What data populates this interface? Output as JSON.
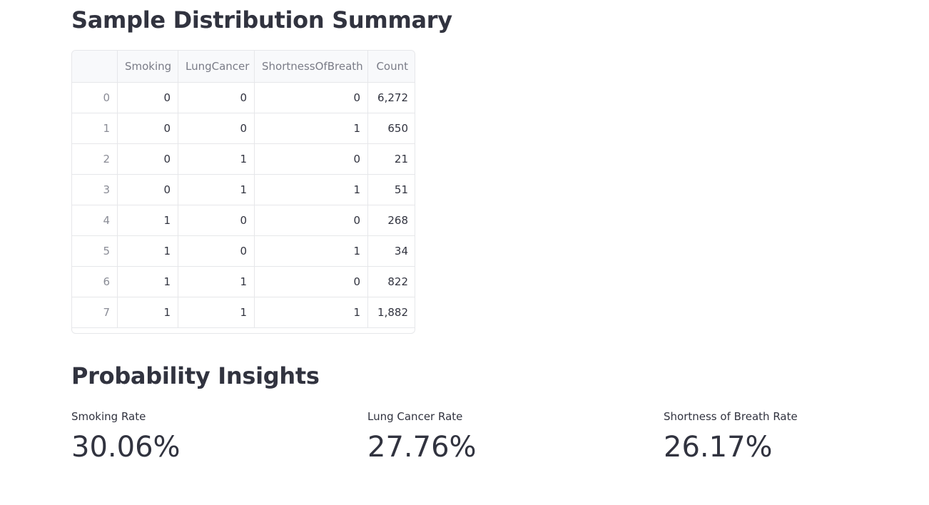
{
  "sections": {
    "distribution_title": "Sample Distribution Summary",
    "probability_title": "Probability Insights"
  },
  "table": {
    "columns": [
      "",
      "Smoking",
      "LungCancer",
      "ShortnessOfBreath",
      "Count"
    ],
    "rows": [
      [
        "0",
        "0",
        "0",
        "0",
        "6,272"
      ],
      [
        "1",
        "0",
        "0",
        "1",
        "650"
      ],
      [
        "2",
        "0",
        "1",
        "0",
        "21"
      ],
      [
        "3",
        "0",
        "1",
        "1",
        "51"
      ],
      [
        "4",
        "1",
        "0",
        "0",
        "268"
      ],
      [
        "5",
        "1",
        "0",
        "1",
        "34"
      ],
      [
        "6",
        "1",
        "1",
        "0",
        "822"
      ],
      [
        "7",
        "1",
        "1",
        "1",
        "1,882"
      ]
    ]
  },
  "metrics": [
    {
      "label": "Smoking Rate",
      "value": "30.06%"
    },
    {
      "label": "Lung Cancer Rate",
      "value": "27.76%"
    },
    {
      "label": "Shortness of Breath Rate",
      "value": "26.17%"
    }
  ]
}
